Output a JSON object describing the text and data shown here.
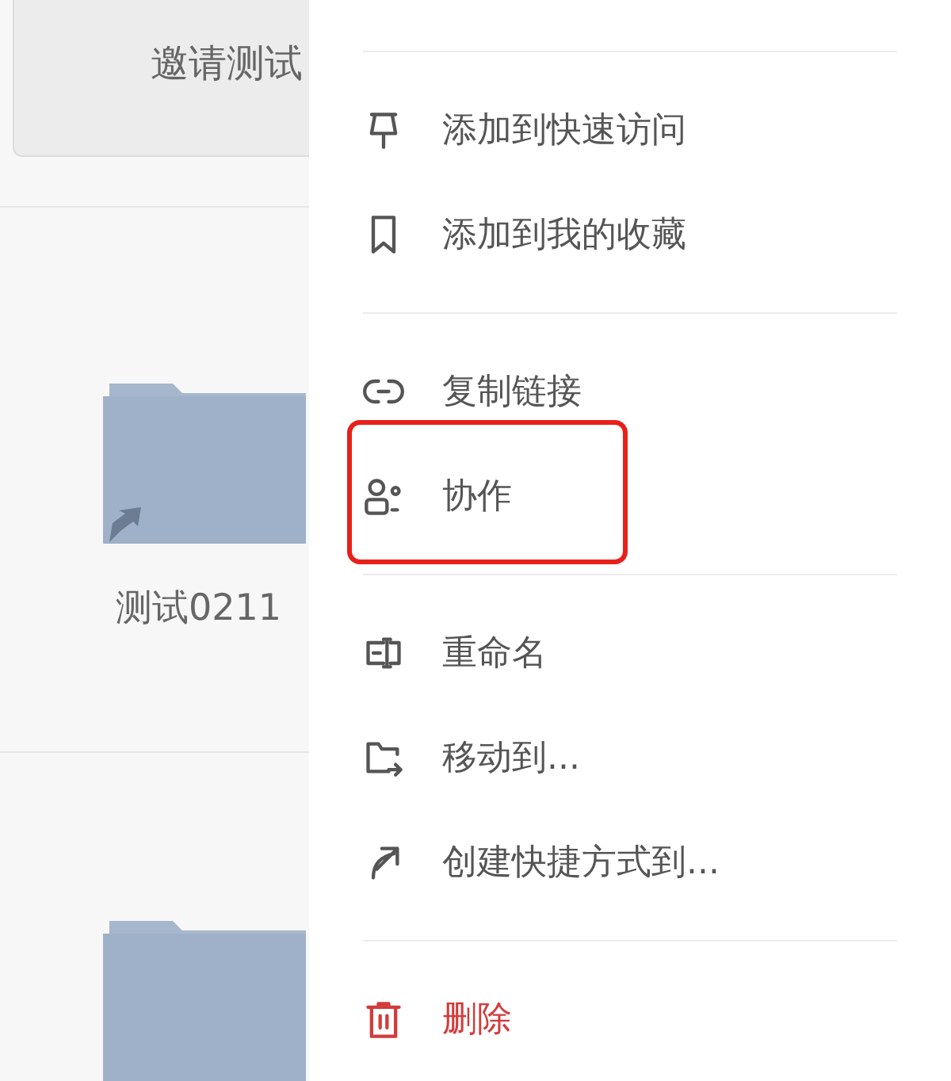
{
  "background": {
    "card_title": "邀请测试",
    "folders": [
      {
        "name": "测试0211",
        "shortcut": true
      },
      {
        "shortcut": false
      }
    ]
  },
  "context_menu": {
    "sections": [
      [
        {
          "label": "添加到快速访问",
          "kind": "normal",
          "highlighted": false
        },
        {
          "label": "添加到我的收藏",
          "kind": "normal",
          "highlighted": false
        }
      ],
      [
        {
          "label": "复制链接",
          "kind": "normal",
          "highlighted": false
        },
        {
          "label": "协作",
          "kind": "normal",
          "highlighted": true
        }
      ],
      [
        {
          "label": "重命名",
          "kind": "normal",
          "highlighted": false
        },
        {
          "label": "移动到...",
          "kind": "normal",
          "highlighted": false
        },
        {
          "label": "创建快捷方式到...",
          "kind": "normal",
          "highlighted": false
        }
      ],
      [
        {
          "label": "删除",
          "kind": "danger",
          "highlighted": false
        }
      ]
    ]
  }
}
